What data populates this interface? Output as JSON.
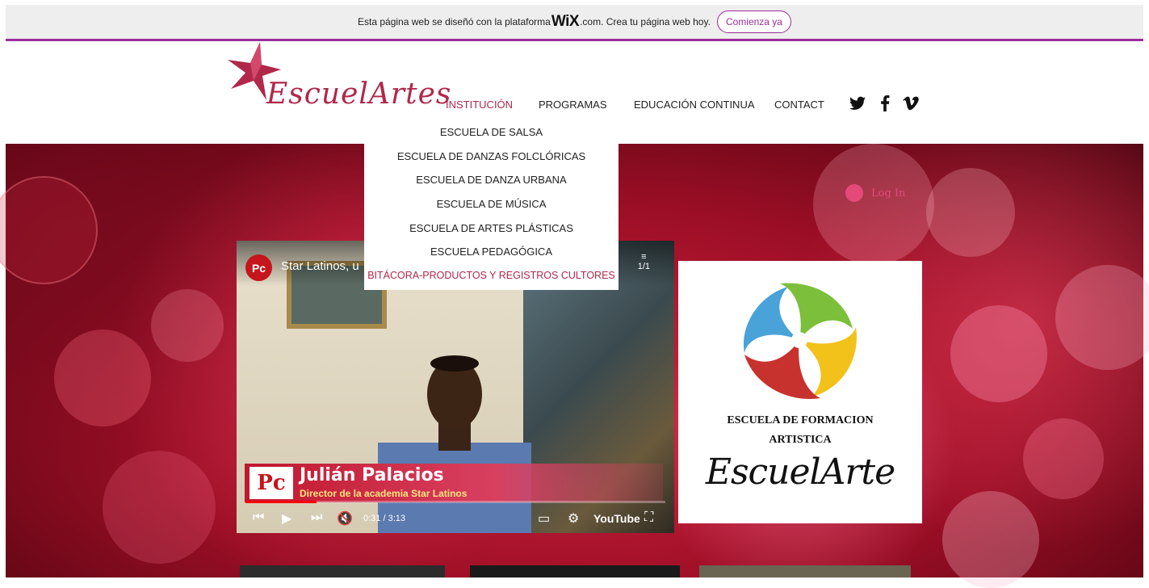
{
  "banner": {
    "text_before": "Esta página web se diseñó con la plataforma",
    "wix_logo": "WiX",
    "text_after": ".com. Crea tu página web hoy.",
    "cta_label": "Comienza ya"
  },
  "header": {
    "logo_text": "EscuelArtes",
    "nav": [
      {
        "label": "INSTITUCIÓN",
        "active": true
      },
      {
        "label": "PROGRAMAS",
        "active": false
      },
      {
        "label": "EDUCACIÓN CONTINUA",
        "active": false
      },
      {
        "label": "CONTACT",
        "active": false
      }
    ],
    "social_icons": [
      "twitter-icon",
      "facebook-icon",
      "vimeo-icon"
    ],
    "social_glyphs": [
      "🐦",
      "f",
      "v"
    ]
  },
  "dropdown": {
    "items": [
      "ESCUELA DE SALSA",
      "ESCUELA DE DANZAS FOLCLÓRICAS",
      "ESCUELA DE DANZA URBANA",
      "ESCUELA DE MÚSICA",
      "ESCUELA DE ARTES PLÁSTICAS",
      "ESCUELA PEDAGÓGICA",
      "BITÁCORA-PRODUCTOS Y REGISTROS CULTORES"
    ]
  },
  "login": {
    "label": "Log In"
  },
  "video": {
    "channel_logo": "Pc",
    "title": "Star Latinos, u",
    "playlist_count": "1/1",
    "lower_third_logo": "Pc",
    "person_name": "Julián Palacios",
    "person_role": "Director de la academia Star Latinos",
    "time": "0:31 / 3:13",
    "progress": 0.17,
    "youtube_label": "YouTube"
  },
  "card": {
    "caption_line1": "ESCUELA DE FORMACION",
    "caption_line2": "ARTISTICA",
    "script_text": "EscuelArte"
  },
  "colors": {
    "accent": "#b0284a",
    "banner_border": "#9b2d9b",
    "login": "#e44a79"
  }
}
